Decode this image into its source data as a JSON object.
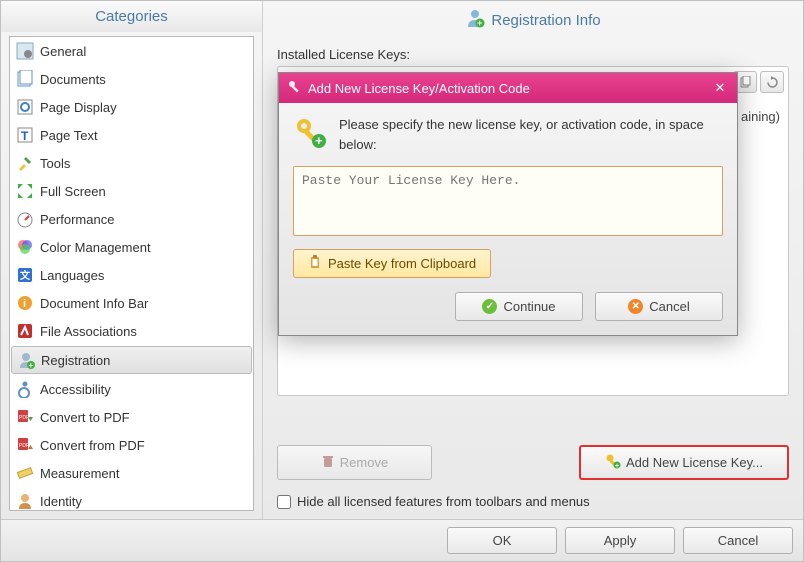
{
  "header": {
    "categories": "Categories",
    "registration": "Registration Info"
  },
  "categories": [
    {
      "label": "General"
    },
    {
      "label": "Documents"
    },
    {
      "label": "Page Display"
    },
    {
      "label": "Page Text"
    },
    {
      "label": "Tools"
    },
    {
      "label": "Full Screen"
    },
    {
      "label": "Performance"
    },
    {
      "label": "Color Management"
    },
    {
      "label": "Languages"
    },
    {
      "label": "Document Info Bar"
    },
    {
      "label": "File Associations"
    },
    {
      "label": "Registration",
      "selected": true
    },
    {
      "label": "Accessibility"
    },
    {
      "label": "Convert to PDF"
    },
    {
      "label": "Convert from PDF"
    },
    {
      "label": "Measurement"
    },
    {
      "label": "Identity"
    }
  ],
  "installed_label": "Installed License Keys:",
  "key_entry_suffix": "aining)",
  "remove_label": "Remove",
  "add_label": "Add New License Key...",
  "hide_label": "Hide all licensed features from toolbars and menus",
  "buttons": {
    "ok": "OK",
    "apply": "Apply",
    "cancel": "Cancel"
  },
  "dialog": {
    "title": "Add New License Key/Activation Code",
    "spec_text": "Please specify the new license key, or activation code, in space below:",
    "placeholder": "Paste Your License Key Here.",
    "paste_clip": "Paste Key from Clipboard",
    "continue": "Continue",
    "cancel": "Cancel"
  }
}
